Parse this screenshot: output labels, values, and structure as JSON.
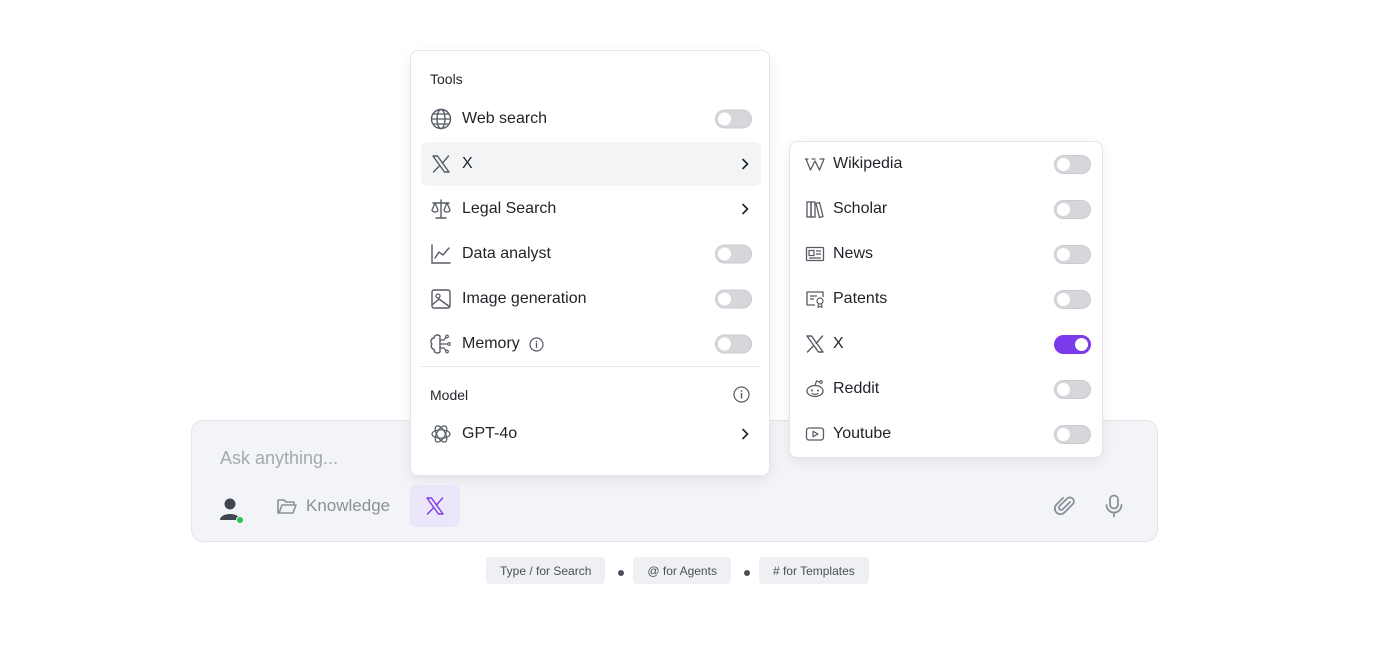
{
  "composer": {
    "placeholder": "Ask anything...",
    "knowledge_label": "Knowledge"
  },
  "hints": [
    "Type / for Search",
    "@ for Agents",
    "# for Templates"
  ],
  "tools_panel": {
    "tools_heading": "Tools",
    "items": [
      {
        "label": "Web search",
        "icon": "globe-icon",
        "control": "toggle",
        "on": false
      },
      {
        "label": "X",
        "icon": "x-logo-icon",
        "control": "chevron",
        "active": true
      },
      {
        "label": "Legal Search",
        "icon": "scales-icon",
        "control": "chevron"
      },
      {
        "label": "Data analyst",
        "icon": "chart-line-icon",
        "control": "toggle",
        "on": false
      },
      {
        "label": "Image generation",
        "icon": "image-icon",
        "control": "toggle",
        "on": false
      },
      {
        "label": "Memory",
        "icon": "brain-icon",
        "control": "toggle",
        "on": false
      }
    ],
    "model_heading": "Model",
    "model_label": "GPT-4o"
  },
  "sources_panel": {
    "items": [
      {
        "label": "Wikipedia",
        "icon": "wikipedia-icon",
        "on": false
      },
      {
        "label": "Scholar",
        "icon": "books-icon",
        "on": false
      },
      {
        "label": "News",
        "icon": "newspaper-icon",
        "on": false
      },
      {
        "label": "Patents",
        "icon": "certificate-icon",
        "on": false
      },
      {
        "label": "X",
        "icon": "x-logo-icon",
        "on": true
      },
      {
        "label": "Reddit",
        "icon": "reddit-icon",
        "on": false
      },
      {
        "label": "Youtube",
        "icon": "youtube-icon",
        "on": false
      }
    ]
  },
  "colors": {
    "accent": "#7c3aed",
    "status_online": "#22c55e"
  }
}
